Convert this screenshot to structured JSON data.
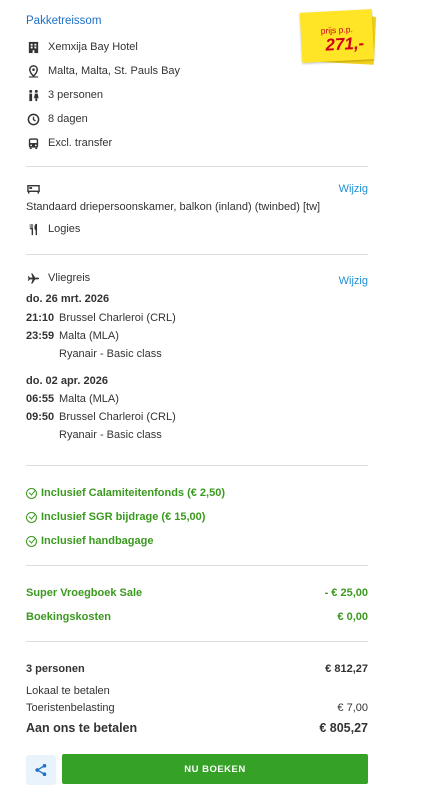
{
  "package": {
    "title": "Pakketreissom",
    "price_label": "prijs p.p.",
    "price_value": "271,-",
    "hotel": "Xemxija Bay Hotel",
    "location": "Malta, Malta, St. Pauls Bay",
    "persons": "3 personen",
    "duration": "8 dagen",
    "transfer": "Excl. transfer"
  },
  "room": {
    "edit_label": "Wijzig",
    "description": "Standaard driepersoonskamer, balkon (inland) (twinbed) [tw]",
    "board": "Logies"
  },
  "flight": {
    "title": "Vliegreis",
    "edit_label": "Wijzig",
    "legs": [
      {
        "date": "do. 26 mrt. 2026",
        "dep_time": "21:10",
        "dep_airport": "Brussel Charleroi (CRL)",
        "arr_time": "23:59",
        "arr_airport": "Malta (MLA)",
        "carrier": "Ryanair - Basic class"
      },
      {
        "date": "do. 02 apr. 2026",
        "dep_time": "06:55",
        "dep_airport": "Malta (MLA)",
        "arr_time": "09:50",
        "arr_airport": "Brussel Charleroi (CRL)",
        "carrier": "Ryanair - Basic class"
      }
    ]
  },
  "inclusions": [
    "Inclusief Calamiteitenfonds (€ 2,50)",
    "Inclusief SGR bijdrage (€ 15,00)",
    "Inclusief handbagage"
  ],
  "discounts": [
    {
      "label": "Super Vroegboek Sale",
      "value": "- € 25,00"
    },
    {
      "label": "Boekingskosten",
      "value": "€ 0,00"
    }
  ],
  "totals": {
    "persons_label": "3 personen",
    "persons_value": "€ 812,27",
    "local_label": "Lokaal te betalen",
    "tax_label": "Toeristenbelasting",
    "tax_value": "€ 7,00",
    "pay_label": "Aan ons te betalen",
    "pay_value": "€ 805,27"
  },
  "actions": {
    "book_label": "NU BOEKEN"
  },
  "colors": {
    "accent_blue": "#1f6fc5",
    "green": "#3a9a1e",
    "button_green": "#36a127",
    "price_red": "#d0021b",
    "tag_yellow": "#ffe526"
  }
}
